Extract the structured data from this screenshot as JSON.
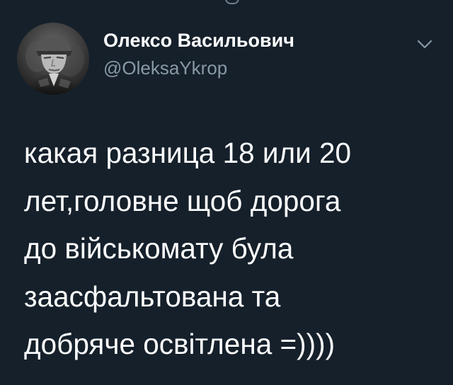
{
  "app": {
    "theme": "dark",
    "background_color": "#15202b",
    "secondary_text_color": "#8899a6"
  },
  "tweet": {
    "author": {
      "display_name": "Олексо Васильович",
      "handle": "@OleksaYkrop",
      "avatar_icon": "soldier-avatar"
    },
    "menu_icon": "chevron-down-icon",
    "text_lines": [
      "какая разница 18 или 20",
      "лет,головне щоб дорога",
      "до військомату була",
      "заасфальтована та",
      "добряче освітлена =))))"
    ]
  }
}
